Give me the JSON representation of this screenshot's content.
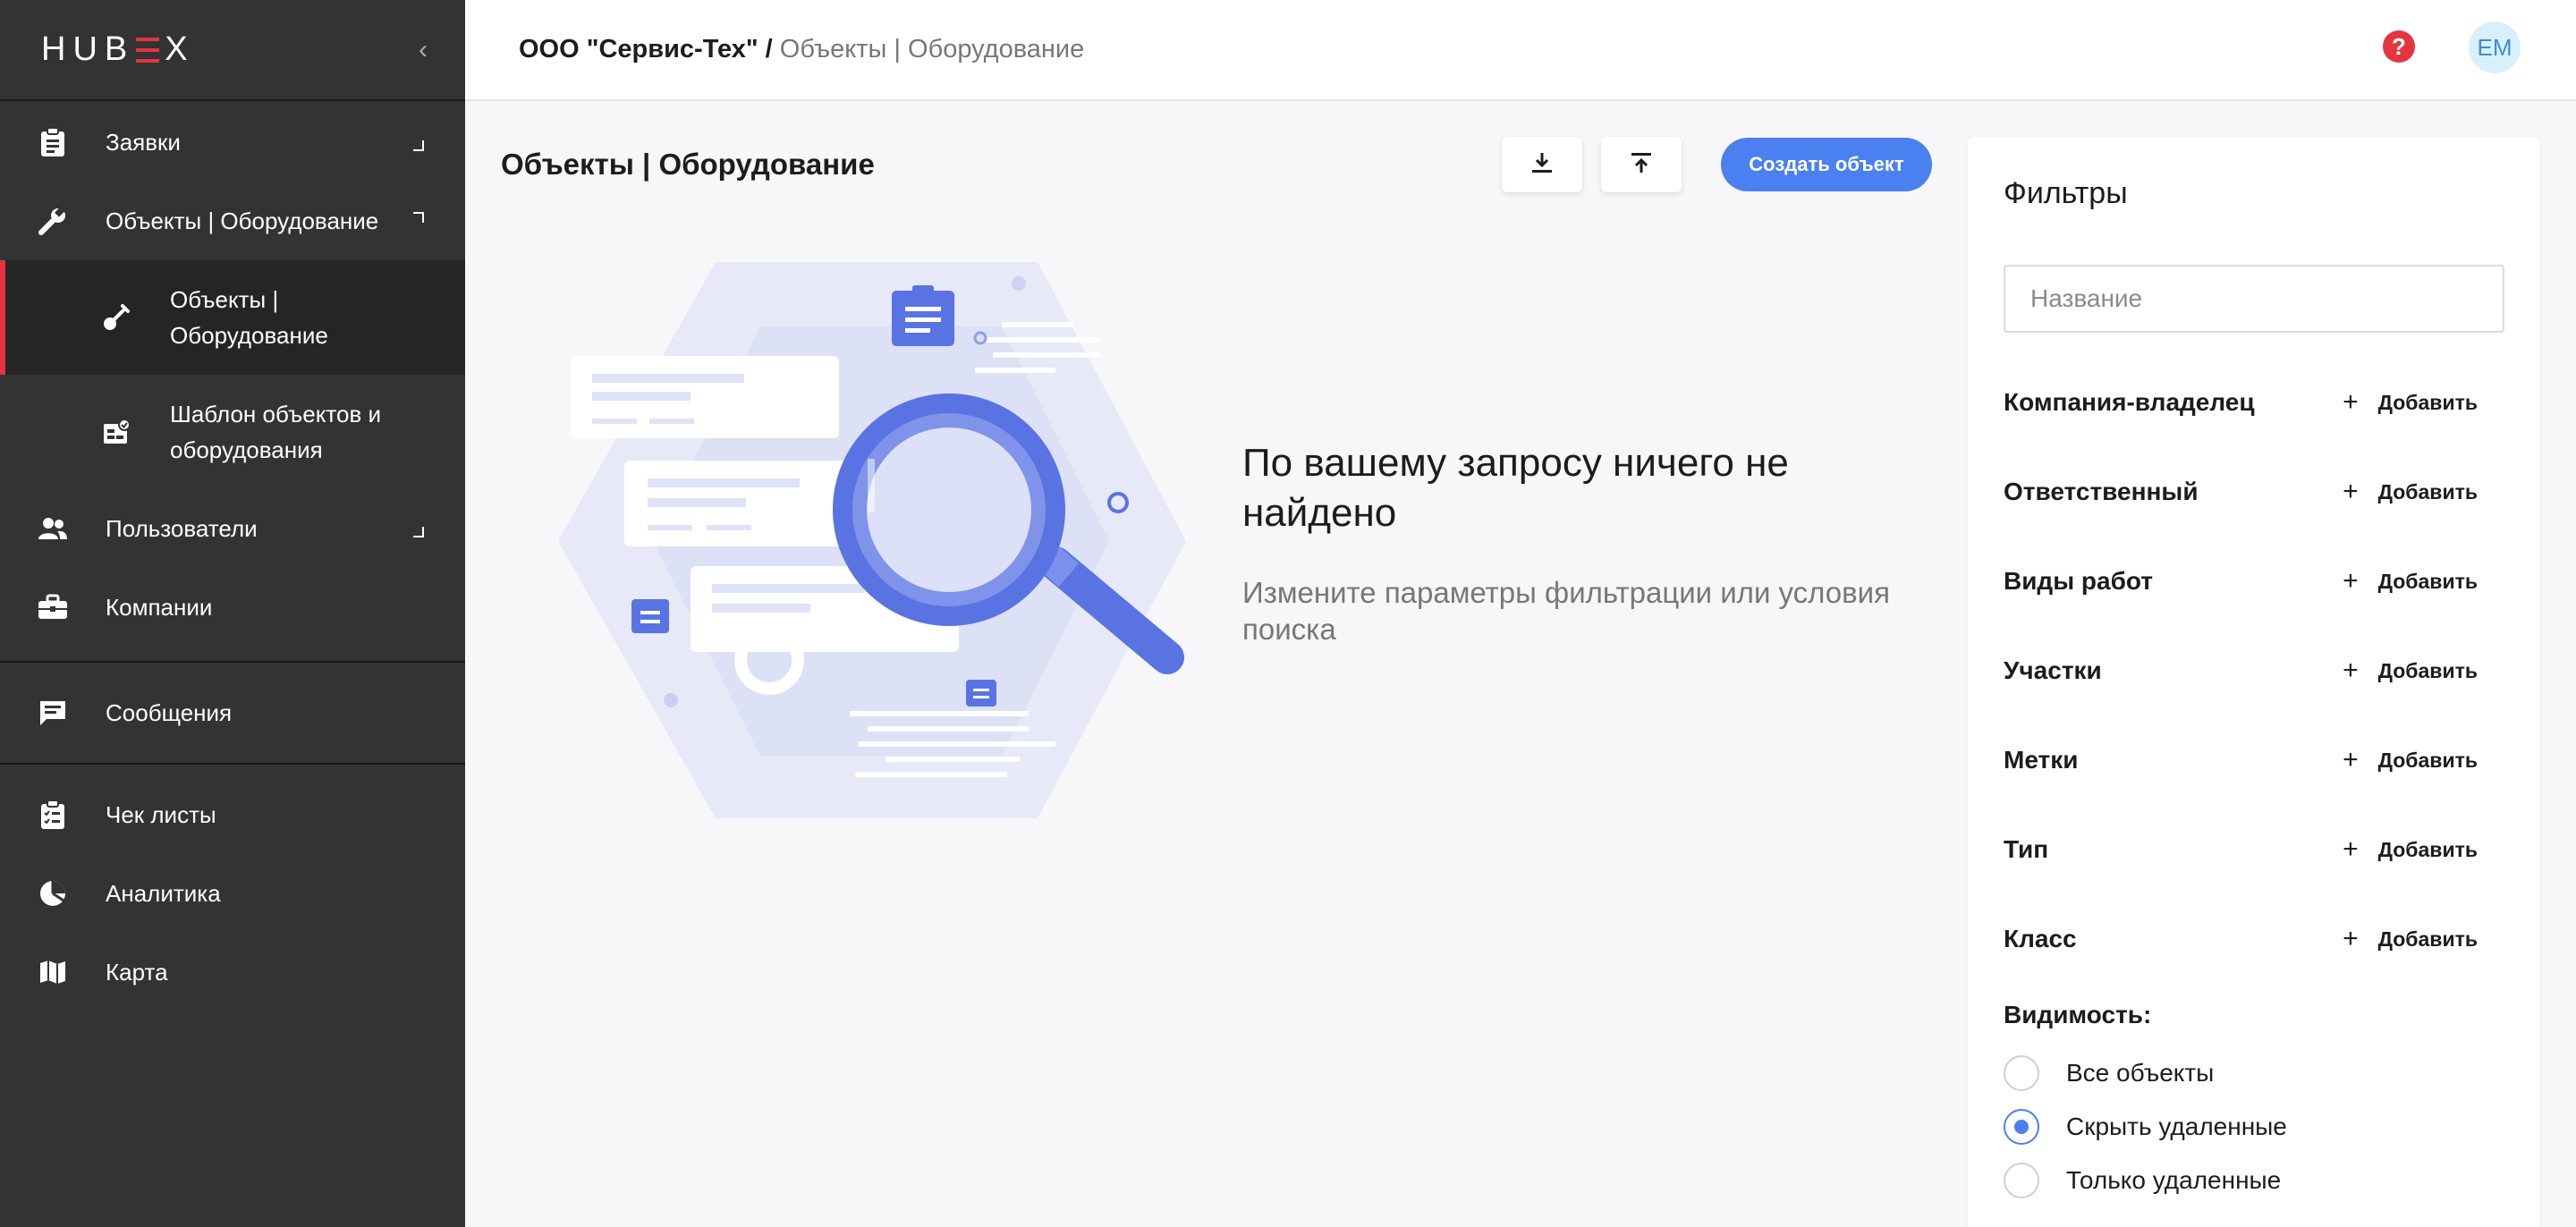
{
  "app": {
    "logo": "HUBEX"
  },
  "sidebar": {
    "items": [
      {
        "label": "Заявки",
        "icon": "clipboard-icon"
      },
      {
        "label": "Объекты | Оборудование",
        "icon": "wrench-icon"
      },
      {
        "label": "Объекты | Оборудование",
        "icon": "shovel-icon",
        "active": true
      },
      {
        "label": "Шаблон объектов и оборудования",
        "icon": "template-icon"
      },
      {
        "label": "Пользователи",
        "icon": "users-icon"
      },
      {
        "label": "Компании",
        "icon": "briefcase-icon"
      },
      {
        "label": "Сообщения",
        "icon": "chat-icon"
      },
      {
        "label": "Чек листы",
        "icon": "checklist-icon"
      },
      {
        "label": "Аналитика",
        "icon": "pie-chart-icon"
      },
      {
        "label": "Карта",
        "icon": "map-icon"
      }
    ]
  },
  "header": {
    "company": "ООО \"Сервис-Тех\" /",
    "section": "Объекты | Оборудование",
    "avatar_initials": "ЕМ",
    "help_icon": "help-icon"
  },
  "main": {
    "title": "Объекты | Оборудование",
    "create_button": "Создать объект",
    "empty_title": "По вашему запросу ничего не найдено",
    "empty_subtitle": "Измените параметры фильтрации или условия поиска"
  },
  "filters": {
    "title": "Фильтры",
    "name_placeholder": "Название",
    "add_label": "Добавить",
    "rows": [
      "Компания-владелец",
      "Ответственный",
      "Виды работ",
      "Участки",
      "Метки",
      "Тип",
      "Класс"
    ],
    "visibility_title": "Видимость:",
    "visibility_options": [
      "Все объекты",
      "Скрыть удаленные",
      "Только удаленные"
    ],
    "visibility_selected": "Скрыть удаленные"
  },
  "colors": {
    "accent": "#4a80f0",
    "brand_red": "#e5343f",
    "sidebar": "#333333"
  }
}
